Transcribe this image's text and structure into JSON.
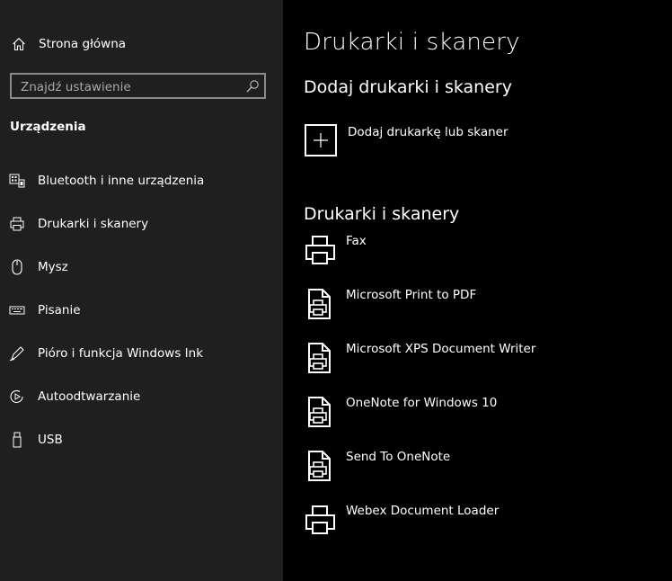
{
  "sidebar": {
    "home_label": "Strona główna",
    "search_placeholder": "Znajdź ustawienie",
    "section_title": "Urządzenia",
    "items": [
      {
        "label": "Bluetooth i inne urządzenia",
        "icon": "bluetooth-devices-icon"
      },
      {
        "label": "Drukarki i skanery",
        "icon": "printer-icon"
      },
      {
        "label": "Mysz",
        "icon": "mouse-icon"
      },
      {
        "label": "Pisanie",
        "icon": "keyboard-icon"
      },
      {
        "label": "Pióro i funkcja Windows Ink",
        "icon": "pen-icon"
      },
      {
        "label": "Autoodtwarzanie",
        "icon": "autoplay-icon"
      },
      {
        "label": "USB",
        "icon": "usb-icon"
      }
    ]
  },
  "main": {
    "page_title": "Drukarki i skanery",
    "add_section_title": "Dodaj drukarki i skanery",
    "add_button_label": "Dodaj drukarkę lub skaner",
    "list_section_title": "Drukarki i skanery",
    "printers": [
      {
        "name": "Fax",
        "icon": "fax-printer-icon"
      },
      {
        "name": "Microsoft Print to PDF",
        "icon": "document-printer-icon"
      },
      {
        "name": "Microsoft XPS Document Writer",
        "icon": "document-printer-icon"
      },
      {
        "name": "OneNote for Windows 10",
        "icon": "document-printer-icon"
      },
      {
        "name": "Send To OneNote",
        "icon": "document-printer-icon"
      },
      {
        "name": "Webex Document Loader",
        "icon": "printer-icon"
      }
    ]
  },
  "colors": {
    "sidebar_bg": "#1f1f1f",
    "main_bg": "#000000",
    "text": "#ffffff",
    "search_border": "#8a8a8a"
  }
}
